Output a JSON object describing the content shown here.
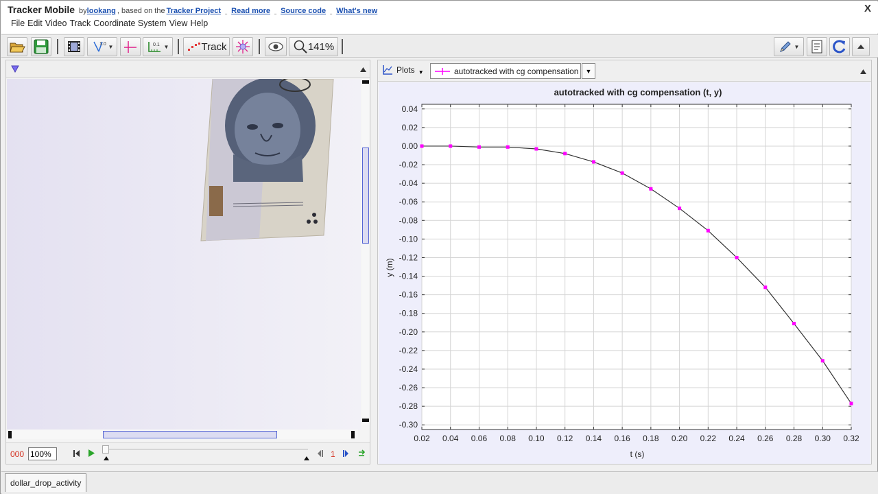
{
  "header": {
    "app_title": "Tracker Mobile",
    "by_text": "by",
    "author": "lookang",
    "based_on": ", based on the",
    "project_link": "Tracker Project",
    "read_more": "Read more",
    "source_code": "Source code",
    "whats_new": "What's new",
    "close": "X"
  },
  "menu": [
    "File",
    "Edit",
    "Video",
    "Track",
    "Coordinate System",
    "View",
    "Help"
  ],
  "toolbar": {
    "track_label": "Track",
    "zoom": "141%",
    "calib_label": "1.0",
    "ruler_label": "0.1"
  },
  "player": {
    "frame_counter": "000",
    "zoom_field": "100%",
    "step_size": "1"
  },
  "plots": {
    "menu_label": "Plots",
    "track_selected": "autotracked with cg compensation"
  },
  "bottom_tab": {
    "label": "dollar_drop_activity"
  },
  "colors": {
    "accent_link": "#1a4fb0",
    "track_color": "#ff00ff",
    "plot_bg": "#eeeefb"
  },
  "chart_data": {
    "type": "line",
    "title": "autotracked with cg compensation (t, y)",
    "xlabel": "t (s)",
    "ylabel": "y (m)",
    "xlim": [
      0.02,
      0.32
    ],
    "ylim": [
      -0.305,
      0.045
    ],
    "grid": true,
    "x_ticks": [
      "0.02",
      "0.04",
      "0.06",
      "0.08",
      "0.10",
      "0.12",
      "0.14",
      "0.16",
      "0.18",
      "0.20",
      "0.22",
      "0.24",
      "0.26",
      "0.28",
      "0.30",
      "0.32"
    ],
    "y_ticks": [
      "0.04",
      "0.02",
      "0.00",
      "-0.02",
      "-0.04",
      "-0.06",
      "-0.08",
      "-0.10",
      "-0.12",
      "-0.14",
      "-0.16",
      "-0.18",
      "-0.20",
      "-0.22",
      "-0.24",
      "-0.26",
      "-0.28",
      "-0.30"
    ],
    "series": [
      {
        "x": [
          0.02,
          0.04,
          0.06,
          0.08,
          0.1,
          0.12,
          0.14,
          0.16,
          0.18,
          0.2,
          0.22,
          0.24,
          0.26,
          0.28,
          0.3,
          0.32
        ],
        "y": [
          0.0,
          0.0,
          -0.001,
          -0.001,
          -0.003,
          -0.008,
          -0.017,
          -0.029,
          -0.046,
          -0.067,
          -0.091,
          -0.12,
          -0.152,
          -0.191,
          -0.231,
          -0.277
        ],
        "color": "#ff00ff"
      }
    ]
  }
}
